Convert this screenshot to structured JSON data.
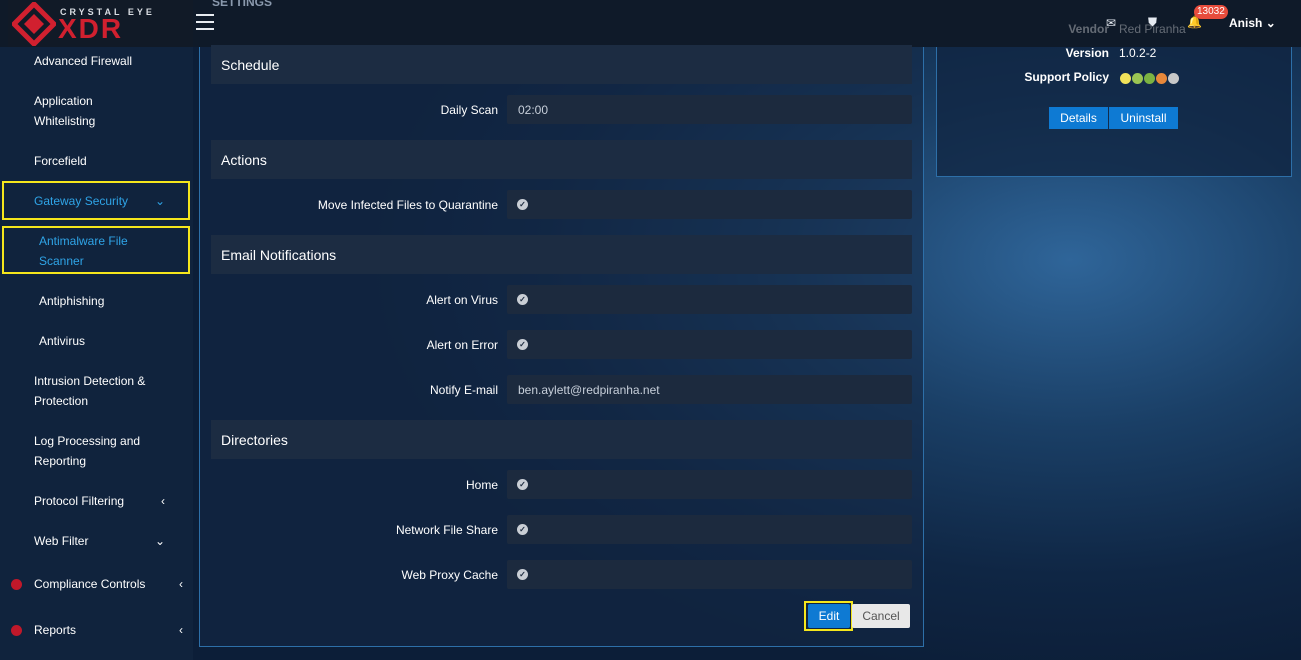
{
  "header": {
    "logo_top": "CRYSTAL EYE",
    "logo_main": "XDR",
    "ghost_title": "SETTINGS",
    "notification_count": "13032",
    "user": "Anish"
  },
  "sidebar": {
    "items": [
      {
        "label": "Advanced Firewall"
      },
      {
        "label": "Application\nWhitelisting"
      },
      {
        "label": "Forcefield"
      },
      {
        "label": "Gateway Security"
      },
      {
        "label": "Antimalware File\nScanner"
      },
      {
        "label": "Antiphishing"
      },
      {
        "label": "Antivirus"
      },
      {
        "label": "Intrusion Detection &\nProtection"
      },
      {
        "label": "Log Processing and\nReporting"
      },
      {
        "label": "Protocol Filtering"
      },
      {
        "label": "Web Filter"
      },
      {
        "label": "Compliance Controls"
      },
      {
        "label": "Reports"
      }
    ]
  },
  "form": {
    "sections": {
      "schedule": "Schedule",
      "actions": "Actions",
      "email": "Email Notifications",
      "directories": "Directories"
    },
    "fields": {
      "daily_scan": {
        "label": "Daily Scan",
        "value": "02:00"
      },
      "move_infected": {
        "label": "Move Infected Files to Quarantine"
      },
      "alert_virus": {
        "label": "Alert on Virus"
      },
      "alert_error": {
        "label": "Alert on Error"
      },
      "notify_email": {
        "label": "Notify E-mail",
        "value": "ben.aylett@redpiranha.net"
      },
      "home": {
        "label": "Home"
      },
      "nfs": {
        "label": "Network File Share"
      },
      "web_proxy": {
        "label": "Web Proxy Cache"
      }
    },
    "buttons": {
      "edit": "Edit",
      "cancel": "Cancel"
    }
  },
  "card": {
    "vendor_label": "Vendor",
    "vendor_value": "Red Piranha",
    "version_label": "Version",
    "version_value": "1.0.2-2",
    "support_label": "Support Policy",
    "support_dots": [
      "#f1e25a",
      "#9bc553",
      "#7cb342",
      "#e8883a",
      "#c8c8c8"
    ],
    "details": "Details",
    "uninstall": "Uninstall"
  },
  "colors": {
    "accent": "#0e7ad3",
    "highlight": "#f5e61c",
    "brand_red": "#d1202f"
  }
}
